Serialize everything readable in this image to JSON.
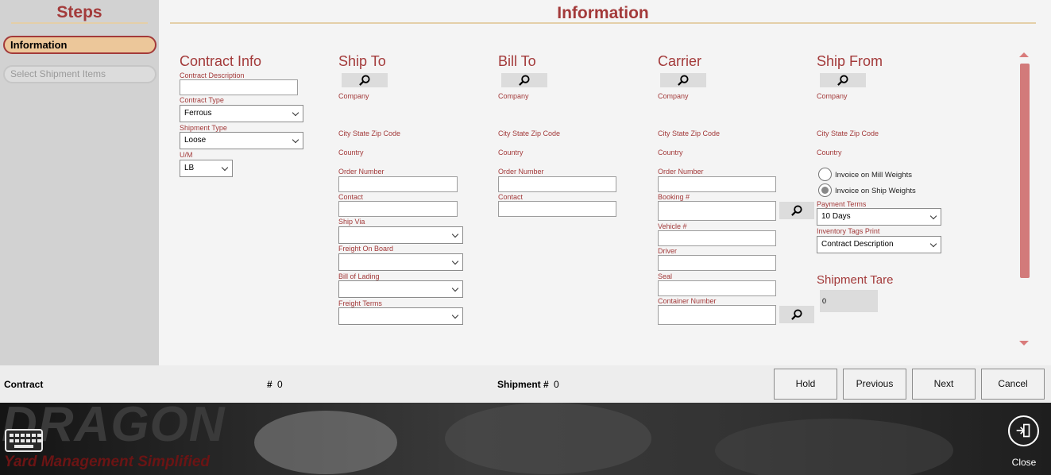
{
  "sidebar": {
    "title": "Steps",
    "steps": [
      {
        "label": "Information",
        "active": true
      },
      {
        "label": "Select Shipment Items",
        "active": false
      }
    ]
  },
  "main": {
    "title": "Information"
  },
  "contract_info": {
    "title": "Contract Info",
    "description_label": "Contract Description",
    "description_value": "",
    "type_label": "Contract Type",
    "type_value": "Ferrous",
    "shipment_type_label": "Shipment Type",
    "shipment_type_value": "Loose",
    "um_label": "U/M",
    "um_value": "LB"
  },
  "ship_to": {
    "title": "Ship To",
    "company_label": "Company",
    "city_label": "City State Zip Code",
    "country_label": "Country",
    "order_label": "Order Number",
    "contact_label": "Contact",
    "ship_via_label": "Ship Via",
    "fob_label": "Freight On Board",
    "bol_label": "Bill of Lading",
    "freight_terms_label": "Freight Terms"
  },
  "bill_to": {
    "title": "Bill To",
    "company_label": "Company",
    "city_label": "City State Zip Code",
    "country_label": "Country",
    "order_label": "Order Number",
    "contact_label": "Contact"
  },
  "carrier": {
    "title": "Carrier",
    "company_label": "Company",
    "city_label": "City State Zip Code",
    "country_label": "Country",
    "order_label": "Order Number",
    "booking_label": "Booking #",
    "vehicle_label": "Vehicle #",
    "driver_label": "Driver",
    "seal_label": "Seal",
    "container_label": "Container Number"
  },
  "ship_from": {
    "title": "Ship From",
    "company_label": "Company",
    "city_label": "City State Zip Code",
    "country_label": "Country",
    "invoice_mill": "Invoice on Mill Weights",
    "invoice_ship": "Invoice on Ship Weights",
    "selected_invoice": "ship",
    "payment_terms_label": "Payment Terms",
    "payment_terms_value": "10 Days",
    "inventory_tags_label": "Inventory Tags Print",
    "inventory_tags_value": "Contract Description",
    "tare_title": "Shipment Tare",
    "tare_value": "0"
  },
  "bottom": {
    "contract_label": "Contract",
    "contract_hash": "#",
    "contract_number": "0",
    "shipment_label": "Shipment #",
    "shipment_number": "0",
    "buttons": {
      "hold": "Hold",
      "previous": "Previous",
      "next": "Next",
      "cancel": "Cancel"
    }
  },
  "footer": {
    "logo": "DRAGON",
    "tagline": "Yard Management Simplified",
    "close_label": "Close"
  },
  "colors": {
    "accent": "#a33a3a",
    "scroll": "#d27a7a",
    "step_active": "#ecc79a"
  },
  "icons": [
    "search-icon",
    "keyboard-icon",
    "exit-icon"
  ]
}
